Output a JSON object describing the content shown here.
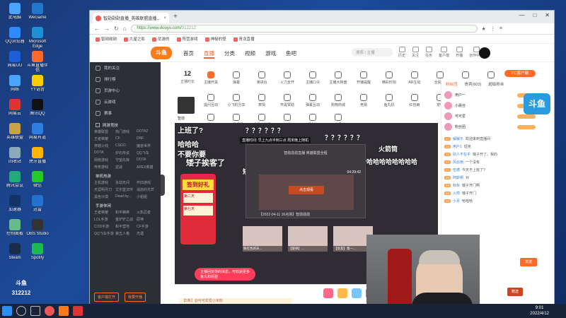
{
  "desktop": {
    "icons": [
      {
        "label": "此电脑",
        "color": "#4aa3ff"
      },
      {
        "label": "QQ浏览器",
        "color": "#2b8bff"
      },
      {
        "label": "网易UU",
        "color": "#1b60d8"
      },
      {
        "label": "网络",
        "color": "#4aa3ff"
      },
      {
        "label": "网易云",
        "color": "#d33"
      },
      {
        "label": "英雄联盟",
        "color": "#c9a24a"
      },
      {
        "label": "回收站",
        "color": "#8ab"
      },
      {
        "label": "腾讯会议",
        "color": "#2a7"
      },
      {
        "label": "加速器",
        "color": "#136"
      },
      {
        "label": "控制面板",
        "color": "#6b8"
      },
      {
        "label": "Steam",
        "color": "#1a2c46"
      },
      {
        "label": "WeGame",
        "color": "#27c"
      },
      {
        "label": "Microsoft Edge",
        "color": "#1f8fd6"
      },
      {
        "label": "斗鱼直播伴侣",
        "color": "#ff6a2a"
      },
      {
        "label": "YY语音",
        "color": "#ffcc00"
      },
      {
        "label": "腾讯QQ",
        "color": "#111"
      },
      {
        "label": "网易有道",
        "color": "#2e7de0"
      },
      {
        "label": "虎牙直播",
        "color": "#ffb400"
      },
      {
        "label": "微信",
        "color": "#2c2"
      },
      {
        "label": "迅雷",
        "color": "#2471d0"
      },
      {
        "label": "OBS Studio",
        "color": "#333"
      },
      {
        "label": "Spotify",
        "color": "#1db954"
      }
    ],
    "big_logo_text": "斗鱼",
    "big_logo_num": "312212"
  },
  "taskbar": {
    "time": "9:01",
    "date": "2022/4/12"
  },
  "browser": {
    "tab_title": "智勋勋勋直播_英雄联盟直播...",
    "url_scheme": "https://",
    "url_host": "www.douyu.com/",
    "url_path": "312212",
    "bookmarks": [
      "智勋勋勋",
      "九星之影",
      "优游的",
      "阵营游戏",
      "神秘的怪",
      "青龙直播"
    ]
  },
  "site": {
    "logo": "斗鱼",
    "nav": [
      "首页",
      "直播",
      "分类",
      "视频",
      "游戏",
      "鱼吧"
    ],
    "active_nav": "直播",
    "search_placeholder": "搜索 / 主播",
    "head_icons": [
      "历史",
      "关注",
      "任务",
      "客户端",
      "开播",
      "创作中心"
    ]
  },
  "sidebar": {
    "items": [
      "我的关注",
      "排行榜",
      "页游中心",
      "云游戏",
      "赛事"
    ],
    "section_game": "网游竞技",
    "games": [
      "英雄联盟",
      "热门游戏",
      "DOTA2",
      "王者荣耀",
      "CF",
      "DNF",
      "穿越火线",
      "CSGO",
      "魔兽世界",
      "DOTA",
      "炉石传说",
      "QQ飞车",
      "网络游戏",
      "守望先锋",
      "DOTA",
      "传奇游戏",
      "逆战",
      "APEX英雄"
    ],
    "section_mobile": "单机热游",
    "mobile": [
      "主机游戏",
      "永劫无间",
      "怀旧游戏",
      "天涯明月刀",
      "艾尔登法环",
      "消逝的光芒",
      "黑色沙漠",
      "Dead by...",
      "小姐姐"
    ],
    "section_hand": "手游休闲",
    "hand": [
      "王者荣耀",
      "和平精英",
      "火影忍者",
      "LOL手游",
      "金铲铲之战",
      "原神",
      "COD手游",
      "和平营地",
      "CF手游",
      "QQ飞车手游",
      "第五人格",
      "光遇"
    ],
    "btn_client": "客户端打开",
    "btn_live": "我要开播"
  },
  "room": {
    "number": "12",
    "number_label": "正播时长",
    "tools_row1": [
      "主播开黑",
      "弹幕",
      "演讲台",
      "火力全开",
      "主播口令",
      "主播大转盘",
      "开播提醒",
      "精彩时刻",
      "AR互动",
      "全民PK",
      "全民红包",
      "更多"
    ],
    "tools_row2": [
      "提问互动",
      "小飞机分享",
      "表情",
      "开黑赞助",
      "弹幕互动",
      "购物商城",
      "竞猜",
      "鱼丸机",
      "红包雨",
      "宠物",
      "礼物",
      "加入公会"
    ],
    "tools_row3": [
      "开播打工",
      "开黑招募",
      "设置直播间",
      "收藏",
      "福利社",
      "会员"
    ],
    "anchor_name": "智勋",
    "pc_client_label": "PC客户端"
  },
  "video": {
    "danmu": [
      {
        "text": "上班了?",
        "size": 10
      },
      {
        "text": "哈哈哈",
        "size": 10
      },
      {
        "text": "不要你要",
        "size": 10
      },
      {
        "text": "矮子挨客了",
        "size": 11
      },
      {
        "text": "？？？？？？",
        "size": 9
      },
      {
        "text": "矮子开门啊",
        "size": 9
      },
      {
        "text": "火箭筒",
        "size": 9
      },
      {
        "text": "哈哈哈哈哈哈哈哈哈",
        "size": 9
      },
      {
        "text": "？？？？？？",
        "size": 9
      }
    ],
    "banner_text": "直播时间: 早上九点半到三点 周末晚上随机",
    "game_title": "智勋勋勋直播 英雄联盟全程",
    "game_time": "04:29:42",
    "game_btn": "点击观看",
    "game_caption": "【2022-04-11 16点场】智勋勋勋",
    "thumbs": [
      {
        "label": "粉红色的天..."
      },
      {
        "label": "【旋律】..."
      },
      {
        "label": "【女友】第一..."
      }
    ],
    "promo_title": "签到好礼",
    "promo_cards": [
      "第二天",
      "第七天"
    ],
    "pill_text": "主播回复你的消息，可收获更多鱼丸和经验",
    "chat_placeholder": "【5条】@可可爱爱小米粉"
  },
  "chat": {
    "tabs": [
      "粉丝团",
      "贵宾(603)",
      "超级粉丝"
    ],
    "active_tab": "粉丝团",
    "fans": [
      "用户一",
      "小晨丝",
      "可可爱",
      "粉丝团"
    ],
    "messages": [
      {
        "lv": "27",
        "name": "解解子",
        "text": "欢迎来到直播间"
      },
      {
        "lv": "24",
        "name": "用户1",
        "text": "坦克"
      },
      {
        "lv": "18",
        "name": "别人不在乎",
        "text": "矮子开了，我的"
      },
      {
        "lv": "24",
        "name": "风云雨",
        "text": "一个没有"
      },
      {
        "lv": "21",
        "name": "伍德",
        "text": "今天不上班了?"
      },
      {
        "lv": "20",
        "name": "阿斯顿",
        "text": "对"
      },
      {
        "lv": "23",
        "name": "秋秋",
        "text": "矮子开门啊"
      },
      {
        "lv": "28",
        "name": "火箭",
        "text": "矮子开门"
      },
      {
        "lv": "19",
        "name": "小月",
        "text": "哈哈哈"
      }
    ],
    "send_label": "发送",
    "fav_label": "赠送"
  }
}
